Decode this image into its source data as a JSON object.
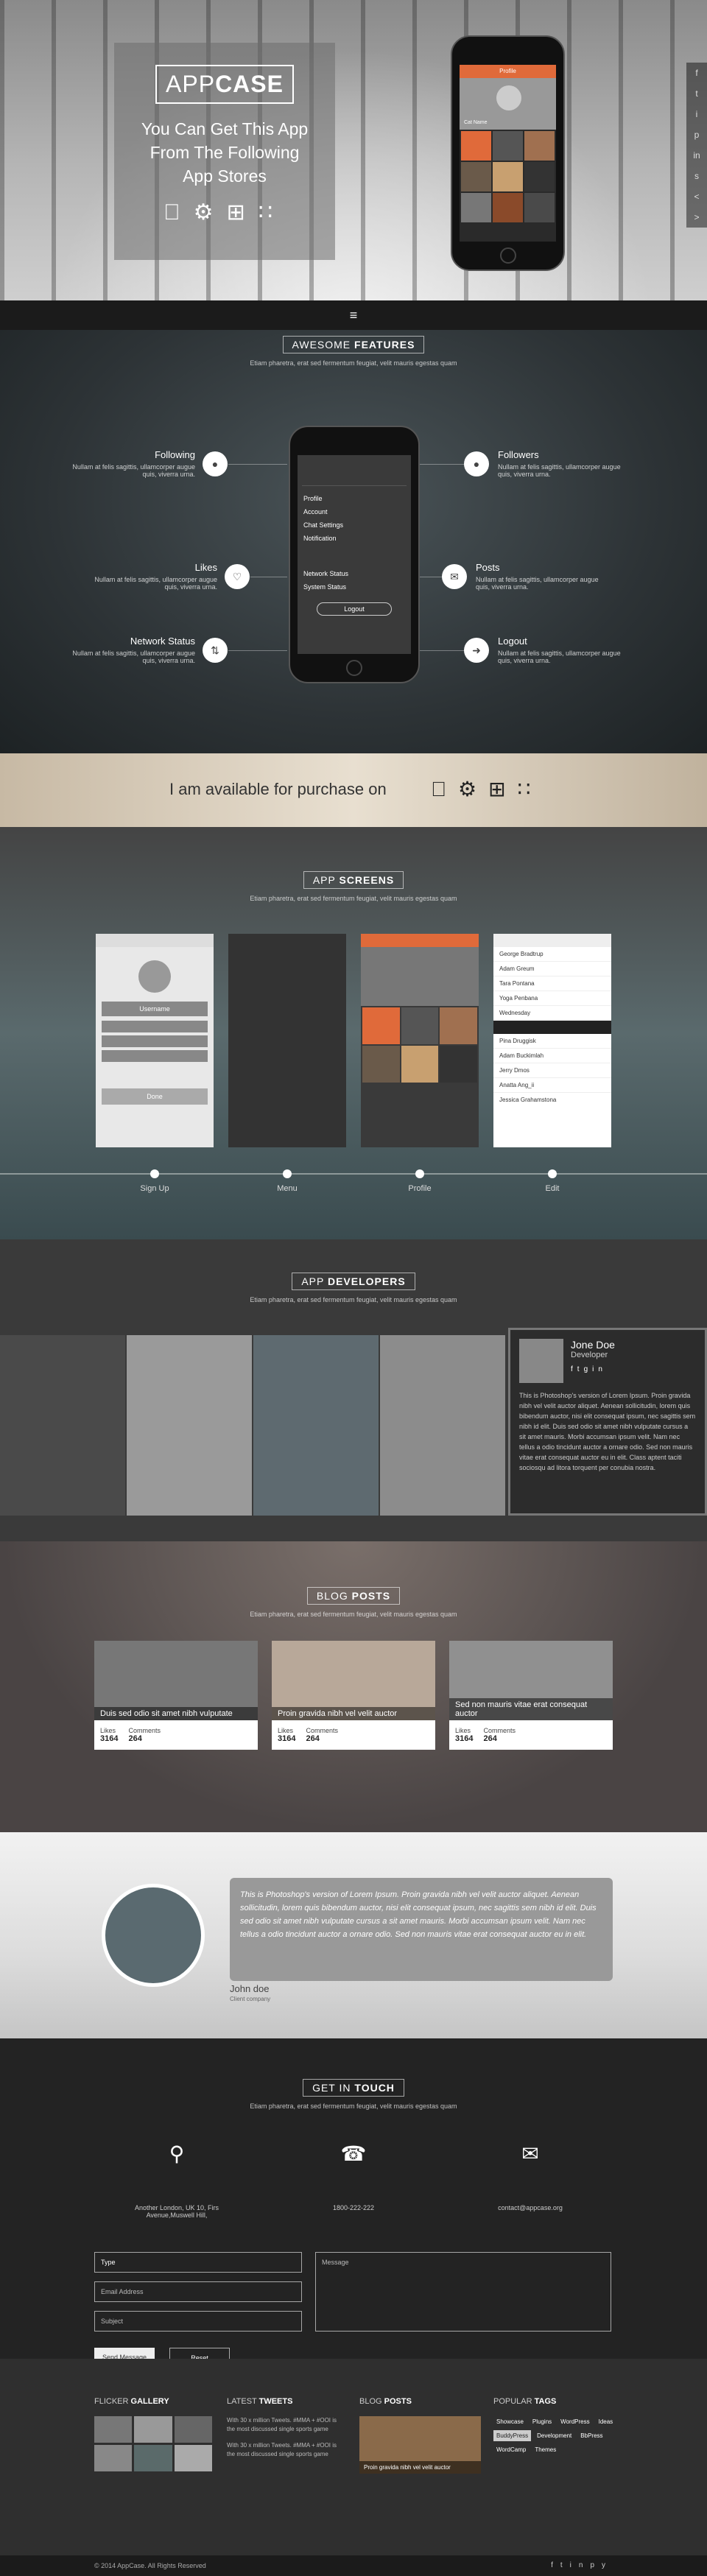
{
  "hero": {
    "logo_light": "APP",
    "logo_bold": "CASE",
    "tagline": "You Can Get This App From The Following App Stores",
    "store_icons": [
      "apple-icon",
      "android-icon",
      "windows-icon",
      "blackberry-icon"
    ]
  },
  "phone_hero": {
    "name": "Cat Name",
    "title": "Profile"
  },
  "social": [
    "f",
    "t",
    "i",
    "p",
    "in",
    "s",
    "<",
    ">"
  ],
  "nav": {
    "menu_icon": "≡"
  },
  "features": {
    "title_light": "AWESOME ",
    "title_bold": "FEATURES",
    "subtitle": "Etiam pharetra, erat sed fermentum feugiat, velit mauris egestas quam",
    "items": [
      {
        "name": "Following",
        "text": "Nullam at felis sagittis, ullamcorper augue quis, viverra urna."
      },
      {
        "name": "Likes",
        "text": "Nullam at felis sagittis, ullamcorper augue quis, viverra urna."
      },
      {
        "name": "Network Status",
        "text": "Nullam at felis sagittis, ullamcorper augue quis, viverra urna."
      },
      {
        "name": "Followers",
        "text": "Nullam at felis sagittis, ullamcorper augue quis, viverra urna."
      },
      {
        "name": "Posts",
        "text": "Nullam at felis sagittis, ullamcorper augue quis, viverra urna."
      },
      {
        "name": "Logout",
        "text": "Nullam at felis sagittis, ullamcorper augue quis, viverra urna."
      }
    ],
    "menu": [
      "Profile",
      "Account",
      "Chat Settings",
      "Notification",
      "Network Status",
      "System Status",
      "Logout"
    ]
  },
  "availability": {
    "text": "I am available for purchase on"
  },
  "screens": {
    "title_light": "APP ",
    "title_bold": "SCREENS",
    "subtitle": "Etiam pharetra, erat sed fermentum feugiat, velit mauris egestas quam",
    "labels": [
      "Sign Up",
      "Menu",
      "Profile",
      "Edit"
    ],
    "signup": {
      "username": "Username",
      "done": "Done"
    },
    "contacts": [
      "George Bradtrup",
      "Adam Greum",
      "Tara Pontana",
      "Yoga Penbana",
      "Wednesday",
      "Pina Druggisk",
      "Adam Buckimlah",
      "Jerry Dmos",
      "Anatta Ang_ii",
      "Jessica Grahamstona"
    ]
  },
  "developers": {
    "title_light": "APP ",
    "title_bold": "DEVELOPERS",
    "subtitle": "Etiam pharetra, erat sed fermentum feugiat, velit mauris egestas quam",
    "card": {
      "name": "Jone Doe",
      "role": "Developer",
      "bio": "This is Photoshop's version of Lorem Ipsum. Proin gravida nibh vel velit auctor aliquet. Aenean sollicitudin, lorem quis bibendum auctor, nisi elit consequat ipsum, nec sagittis sem nibh id elit. Duis sed odio sit amet nibh vulputate cursus a sit amet mauris. Morbi accumsan ipsum velit. Nam nec tellus a odio tincidunt auctor a ornare odio. Sed non mauris vitae erat consequat auctor eu in elit. Class aptent taciti sociosqu ad litora torquent per conubia nostra."
    }
  },
  "blog": {
    "title_light": "BLOG ",
    "title_bold": "POSTS",
    "subtitle": "Etiam pharetra, erat sed fermentum feugiat, velit mauris egestas quam",
    "posts": [
      {
        "caption": "Duis sed odio sit amet nibh vulputate",
        "likes_label": "Likes",
        "likes": "3164",
        "comments_label": "Comments",
        "comments": "264"
      },
      {
        "caption": "Proin gravida nibh vel velit auctor",
        "likes_label": "Likes",
        "likes": "3164",
        "comments_label": "Comments",
        "comments": "264"
      },
      {
        "caption": "Sed non mauris vitae erat consequat auctor",
        "likes_label": "Likes",
        "likes": "3164",
        "comments_label": "Comments",
        "comments": "264"
      }
    ]
  },
  "testimonial": {
    "quote": "This is Photoshop's version of Lorem Ipsum. Proin gravida nibh vel velit auctor aliquet. Aenean sollicitudin, lorem quis bibendum auctor, nisi elit consequat ipsum, nec sagittis sem nibh id elit. Duis sed odio sit amet nibh vulputate cursus a sit amet mauris. Morbi accumsan ipsum velit. Nam nec tellus a odio tincidunt auctor a ornare odio. Sed non mauris vitae erat consequat auctor eu in elit.",
    "author": "John doe",
    "company": "Client company"
  },
  "contact": {
    "title_light": "GET IN ",
    "title_bold": "TOUCH",
    "subtitle": "Etiam pharetra, erat sed fermentum feugiat, velit mauris egestas quam",
    "address": "Another London, UK 10, Firs Avenue,Muswell Hill,",
    "phone": "1800-222-222",
    "email": "contact@appcase.org",
    "form": {
      "name_value": "Type",
      "email_placeholder": "Email Address",
      "subject_placeholder": "Subject",
      "message_placeholder": "Message",
      "send": "Send Message",
      "reset": "Reset"
    }
  },
  "footer": {
    "gallery_title_light": "FLICKER ",
    "gallery_title_bold": "GALLERY",
    "tweets_title_light": "LATEST ",
    "tweets_title_bold": "TWEETS",
    "tweets": [
      "With 30 x million Tweets. #MMA + #OOI is the most discussed single sports game",
      "With 30 x million Tweets. #MMA + #OOI is the most discussed single sports game"
    ],
    "blog_title_light": "BLOG ",
    "blog_title_bold": "POSTS",
    "blog_caption": "Proin gravida nibh vel velit auctor",
    "tags_title_light": "POPULAR ",
    "tags_title_bold": "TAGS",
    "tags": [
      "Showcase",
      "Plugins",
      "WordPress",
      "Ideas",
      "BuddyPress",
      "Development",
      "BbPress",
      "WordCamp",
      "Themes"
    ],
    "copyright": "© 2014 AppCase. All Rights Reserved",
    "bottom_social": [
      "f",
      "t",
      "in",
      "p",
      "y"
    ]
  }
}
